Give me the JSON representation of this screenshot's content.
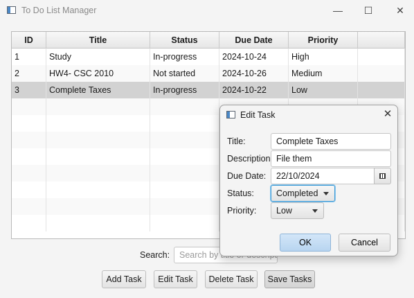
{
  "window": {
    "title": "To Do List Manager",
    "controls": {
      "minimize": "—",
      "maximize": "☐",
      "close": "✕"
    }
  },
  "table": {
    "columns": [
      "ID",
      "Title",
      "Status",
      "Due Date",
      "Priority",
      ""
    ],
    "rows": [
      {
        "id": "1",
        "title": "Study",
        "status": "In-progress",
        "due": "2024-10-24",
        "priority": "High"
      },
      {
        "id": "2",
        "title": "HW4- CSC 2010",
        "status": "Not started",
        "due": "2024-10-26",
        "priority": "Medium"
      },
      {
        "id": "3",
        "title": "Complete Taxes",
        "status": "In-progress",
        "due": "2024-10-22",
        "priority": "Low"
      }
    ],
    "selected_row": 3
  },
  "search": {
    "label": "Search:",
    "placeholder": "Search by title or description"
  },
  "buttons": {
    "add": "Add Task",
    "edit": "Edit Task",
    "delete": "Delete Task",
    "save": "Save Tasks"
  },
  "dialog": {
    "title": "Edit Task",
    "close": "✕",
    "labels": {
      "title": "Title:",
      "description": "Description:",
      "due_date": "Due Date:",
      "status": "Status:",
      "priority": "Priority:"
    },
    "values": {
      "title": "Complete Taxes",
      "description": "File them",
      "due_date": "22/10/2024",
      "status": "Completed",
      "priority": "Low"
    },
    "ok": "OK",
    "cancel": "Cancel"
  },
  "colors": {
    "focus": "#3a9ad6",
    "selected_row": "#d2d2d2",
    "default_button": "#b8d5f0"
  }
}
